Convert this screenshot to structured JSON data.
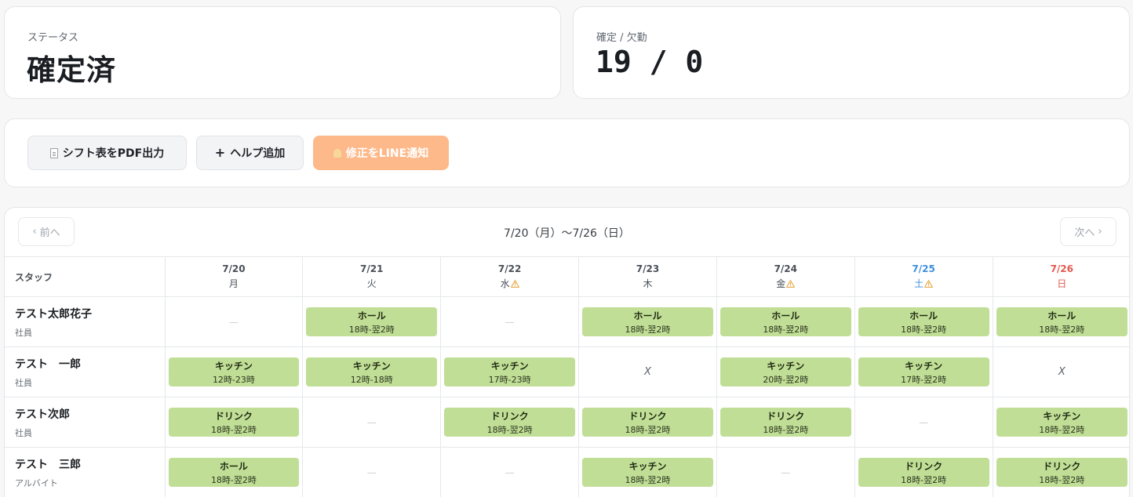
{
  "status_card": {
    "label": "ステータス",
    "value": "確定済"
  },
  "count_card": {
    "label": "確定 / 欠勤",
    "value": "19 / 0"
  },
  "actions": {
    "pdf_label": "シフト表をPDF出力",
    "help_label": "ヘルプ追加",
    "line_label": "修正をLINE通知"
  },
  "nav": {
    "prev": "前へ",
    "next": "次へ",
    "range": "7/20（月）〜7/26（日）"
  },
  "table": {
    "staff_header": "スタッフ",
    "days": [
      {
        "date": "7/20",
        "dow": "月",
        "warn": false,
        "type": "weekday"
      },
      {
        "date": "7/21",
        "dow": "火",
        "warn": false,
        "type": "weekday"
      },
      {
        "date": "7/22",
        "dow": "水",
        "warn": true,
        "type": "weekday"
      },
      {
        "date": "7/23",
        "dow": "木",
        "warn": false,
        "type": "weekday"
      },
      {
        "date": "7/24",
        "dow": "金",
        "warn": true,
        "type": "weekday"
      },
      {
        "date": "7/25",
        "dow": "土",
        "warn": true,
        "type": "sat"
      },
      {
        "date": "7/26",
        "dow": "日",
        "warn": false,
        "type": "sun"
      }
    ],
    "empty_mark": "—",
    "absent_mark": "X",
    "rows": [
      {
        "name": "テスト太郎花子",
        "role": "社員",
        "cells": [
          null,
          {
            "role": "ホール",
            "time": "18時-翌2時"
          },
          null,
          {
            "role": "ホール",
            "time": "18時-翌2時"
          },
          {
            "role": "ホール",
            "time": "18時-翌2時"
          },
          {
            "role": "ホール",
            "time": "18時-翌2時"
          },
          {
            "role": "ホール",
            "time": "18時-翌2時"
          }
        ]
      },
      {
        "name": "テスト　一郎",
        "role": "社員",
        "cells": [
          {
            "role": "キッチン",
            "time": "12時-23時"
          },
          {
            "role": "キッチン",
            "time": "12時-18時"
          },
          {
            "role": "キッチン",
            "time": "17時-23時"
          },
          "absent",
          {
            "role": "キッチン",
            "time": "20時-翌2時"
          },
          {
            "role": "キッチン",
            "time": "17時-翌2時"
          },
          "absent"
        ]
      },
      {
        "name": "テスト次郎",
        "role": "社員",
        "cells": [
          {
            "role": "ドリンク",
            "time": "18時-翌2時"
          },
          null,
          {
            "role": "ドリンク",
            "time": "18時-翌2時"
          },
          {
            "role": "ドリンク",
            "time": "18時-翌2時"
          },
          {
            "role": "ドリンク",
            "time": "18時-翌2時"
          },
          null,
          {
            "role": "キッチン",
            "time": "18時-翌2時"
          }
        ]
      },
      {
        "name": "テスト　三郎",
        "role": "アルバイト",
        "cells": [
          {
            "role": "ホール",
            "time": "18時-翌2時"
          },
          null,
          null,
          {
            "role": "キッチン",
            "time": "18時-翌2時"
          },
          null,
          {
            "role": "ドリンク",
            "time": "18時-翌2時"
          },
          {
            "role": "ドリンク",
            "time": "18時-翌2時"
          }
        ]
      }
    ]
  },
  "colors": {
    "shift_bg": "#c1de96",
    "line_button": "#fdb98a",
    "saturday": "#3f8fdc",
    "sunday": "#e35a4f",
    "warning": "#e8a33d"
  }
}
